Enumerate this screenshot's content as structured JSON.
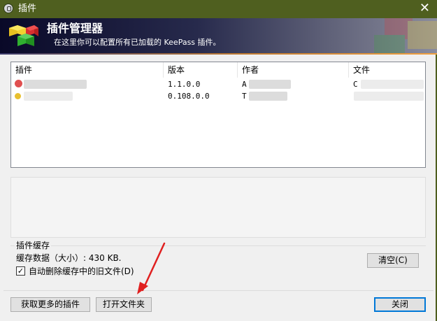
{
  "window": {
    "title": "插件",
    "close_glyph": "✕"
  },
  "banner": {
    "heading": "插件管理器",
    "subheading": "在这里你可以配置所有已加载的 KeePass 插件。"
  },
  "plugin_list": {
    "columns": [
      "插件",
      "版本",
      "作者",
      "文件"
    ],
    "rows": [
      {
        "version": "1.1.0.0",
        "author_prefix": "A",
        "file_prefix": "C"
      },
      {
        "version": "0.108.0.0",
        "author_prefix": "T",
        "file_prefix": ""
      }
    ]
  },
  "cache": {
    "group_title": "插件缓存",
    "info": "缓存数据（大小）: 430 KB.",
    "clear_button": "清空(C)",
    "auto_delete_label": "自动删除缓存中的旧文件(D)",
    "auto_delete_checked": "✓"
  },
  "buttons": {
    "get_more": "获取更多的插件",
    "open_folder": "打开文件夹",
    "close": "关闭"
  },
  "colors": {
    "titlebar": "#4f5f1f",
    "banner_dark": "#090928",
    "accent_orange": "#f0a040",
    "annotation_arrow": "#e02020"
  }
}
